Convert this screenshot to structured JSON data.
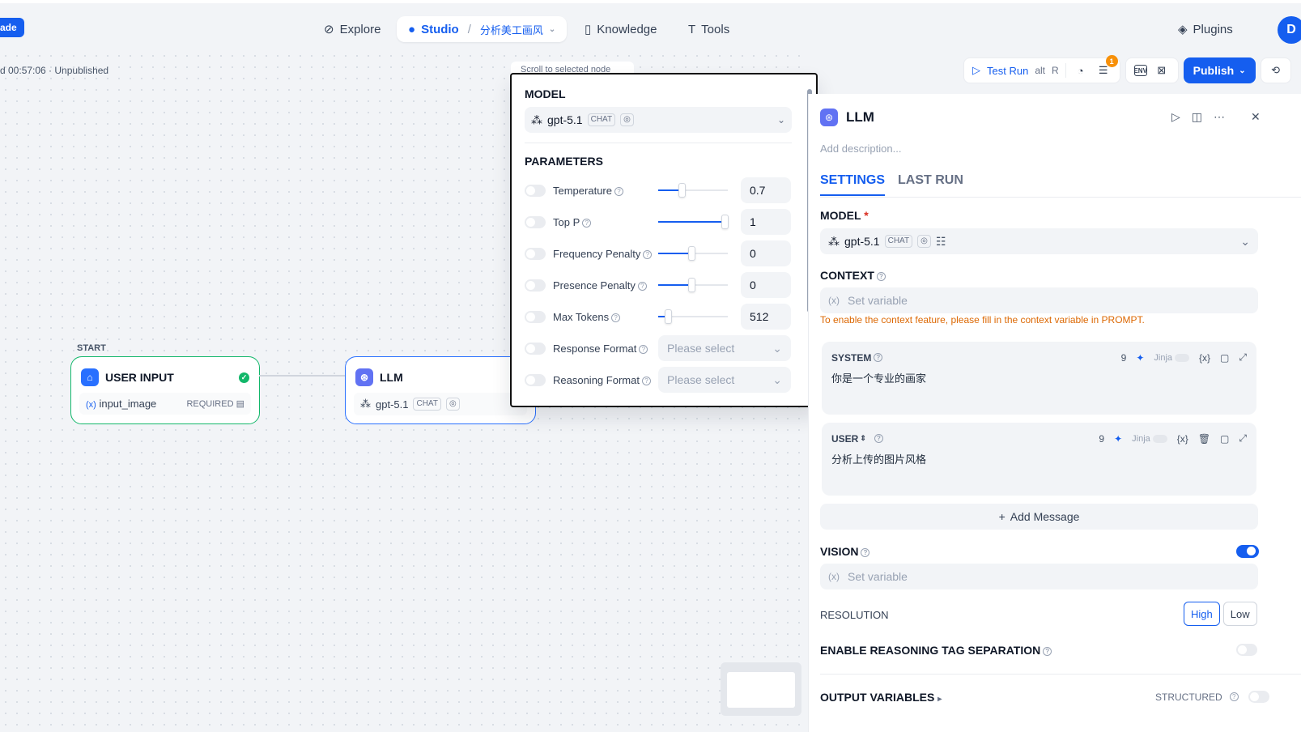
{
  "topbar": {
    "upgrade_label": "ade",
    "nav": [
      {
        "label": "Explore"
      },
      {
        "label": "Studio",
        "app_name": "分析美工画风"
      },
      {
        "label": "Knowledge"
      },
      {
        "label": "Tools"
      }
    ],
    "plugins_label": "Plugins",
    "avatar_initial": "D"
  },
  "canvas": {
    "autosave_text": "d 00:57:06 · Unpublished",
    "scroll_hint": "Scroll to selected node",
    "toolbar": {
      "test_run_label": "Test Run",
      "test_run_shortcut_1": "alt",
      "test_run_shortcut_2": "R",
      "checklist_badge": "1",
      "env_label": "ENV",
      "publish_label": "Publish"
    },
    "start_node": {
      "section_label": "START",
      "title": "USER INPUT",
      "var_name": "input_image",
      "required_label": "REQUIRED"
    },
    "llm_node": {
      "title": "LLM",
      "model": "gpt-5.1",
      "tag": "CHAT"
    }
  },
  "model_popup": {
    "model_title": "MODEL",
    "model_name": "gpt-5.1",
    "model_tag": "CHAT",
    "params_title": "PARAMETERS",
    "params": [
      {
        "label": "Temperature",
        "value": "0.7",
        "level": 0.35
      },
      {
        "label": "Top P",
        "value": "1",
        "level": 1.0
      },
      {
        "label": "Frequency Penalty",
        "value": "0",
        "level": 0.5
      },
      {
        "label": "Presence Penalty",
        "value": "0",
        "level": 0.5
      },
      {
        "label": "Max Tokens",
        "value": "512",
        "level": 0.15
      }
    ],
    "selects": [
      {
        "label": "Response Format",
        "placeholder": "Please select"
      },
      {
        "label": "Reasoning Format",
        "placeholder": "Please select"
      }
    ]
  },
  "panel": {
    "title": "LLM",
    "description_placeholder": "Add description...",
    "tabs": [
      "SETTINGS",
      "LAST RUN"
    ],
    "model_section": {
      "title": "MODEL",
      "required_mark": "*",
      "model_name": "gpt-5.1",
      "tag": "CHAT"
    },
    "context": {
      "title": "CONTEXT",
      "placeholder": "Set variable",
      "warning": "To enable the context feature, please fill in the context variable in PROMPT."
    },
    "system_prompt": {
      "role": "SYSTEM",
      "count": "9",
      "jinja_label": "Jinja",
      "text": "你是一个专业的画家"
    },
    "user_prompt": {
      "role": "USER",
      "count": "9",
      "jinja_label": "Jinja",
      "text": "分析上传的图片风格"
    },
    "add_message_label": "Add Message",
    "vision": {
      "title": "VISION",
      "enabled": true,
      "placeholder": "Set variable"
    },
    "resolution": {
      "label": "RESOLUTION",
      "options": [
        "High",
        "Low"
      ],
      "selected": "High"
    },
    "reasoning_tag": {
      "label": "ENABLE REASONING TAG SEPARATION"
    },
    "output_vars": {
      "label": "OUTPUT VARIABLES",
      "structured_label": "STRUCTURED"
    }
  },
  "colors": {
    "accent": "#155eef",
    "warning": "#dc6803",
    "success": "#12b76a",
    "badge": "#f79009"
  }
}
